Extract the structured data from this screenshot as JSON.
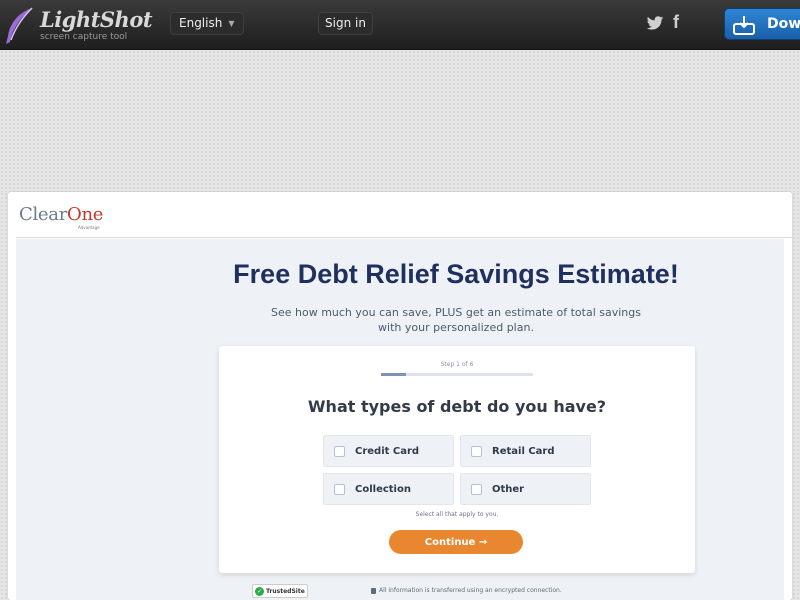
{
  "lightshot": {
    "title": "LightShot",
    "subtitle": "screen capture tool",
    "language": "English",
    "signin": "Sign in",
    "download": "Down",
    "social": [
      "twitter-icon",
      "facebook-icon"
    ]
  },
  "site": {
    "brand_main": "Clear",
    "brand_accent": "One",
    "brand_sub": "Advantage",
    "headline": "Free Debt Relief Savings Estimate!",
    "subline": "See how much you can save, PLUS get an estimate of total savings with your personalized plan."
  },
  "form": {
    "step": "Step 1 of 6",
    "progress": 0.167,
    "question": "What types of debt do you have?",
    "options": [
      "Credit Card",
      "Retail Card",
      "Collection",
      "Other"
    ],
    "hint": "Select all that apply to you.",
    "continue": "Continue →"
  },
  "footer": {
    "trusted": "TrustedSite",
    "secure": "All information is transferred using an encrypted connection."
  },
  "colors": {
    "accent": "#e8872f",
    "headline": "#1f2f5e",
    "brand_accent": "#c0392b"
  }
}
